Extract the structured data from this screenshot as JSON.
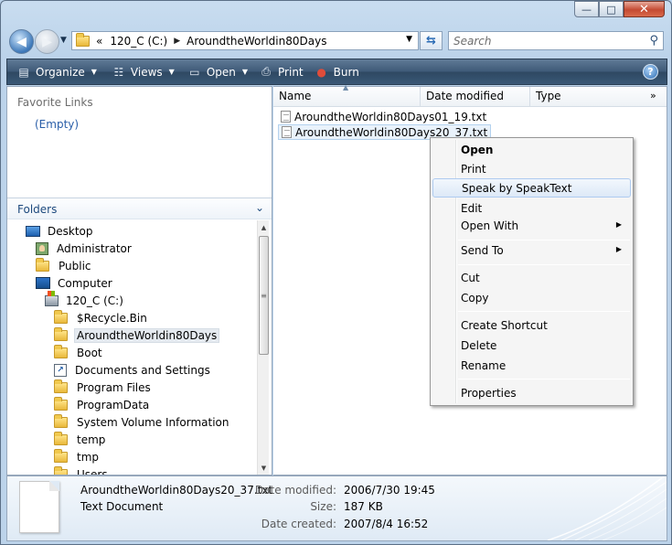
{
  "window": {
    "caption_buttons": {
      "minimize": "—",
      "maximize": "□",
      "close": "✕"
    }
  },
  "nav": {
    "back": "◀",
    "forward": "▶",
    "address": {
      "overflow": "«",
      "crumbs": [
        "120_C (C:)",
        "AroundtheWorldin80Days"
      ]
    },
    "search_placeholder": "Search"
  },
  "toolbar": {
    "items": [
      {
        "label": "Organize",
        "icon": "organize-icon",
        "dropdown": true
      },
      {
        "label": "Views",
        "icon": "views-icon",
        "dropdown": true
      },
      {
        "label": "Open",
        "icon": "open-icon",
        "dropdown": true
      },
      {
        "label": "Print",
        "icon": "printer-icon",
        "dropdown": false
      },
      {
        "label": "Burn",
        "icon": "burn-disc-icon",
        "dropdown": false
      }
    ],
    "help": "?"
  },
  "left": {
    "favorites_title": "Favorite Links",
    "favorites_empty": "(Empty)",
    "folders_title": "Folders",
    "tree": [
      {
        "label": "Desktop",
        "icon": "desktop",
        "indent": 0
      },
      {
        "label": "Administrator",
        "icon": "user",
        "indent": 1
      },
      {
        "label": "Public",
        "icon": "folder",
        "indent": 1
      },
      {
        "label": "Computer",
        "icon": "computer",
        "indent": 1
      },
      {
        "label": "120_C (C:)",
        "icon": "drive",
        "indent": 2
      },
      {
        "label": "$Recycle.Bin",
        "icon": "folder",
        "indent": 3
      },
      {
        "label": "AroundtheWorldin80Days",
        "icon": "folder",
        "indent": 3,
        "selected": true
      },
      {
        "label": "Boot",
        "icon": "folder",
        "indent": 3
      },
      {
        "label": "Documents and Settings",
        "icon": "shortcut",
        "indent": 3
      },
      {
        "label": "Program Files",
        "icon": "folder",
        "indent": 3
      },
      {
        "label": "ProgramData",
        "icon": "folder",
        "indent": 3
      },
      {
        "label": "System Volume Information",
        "icon": "folder",
        "indent": 3
      },
      {
        "label": "temp",
        "icon": "folder",
        "indent": 3
      },
      {
        "label": "tmp",
        "icon": "folder",
        "indent": 3
      },
      {
        "label": "Users",
        "icon": "folder",
        "indent": 3
      }
    ]
  },
  "right": {
    "columns": [
      "Name",
      "Date modified",
      "Type",
      "»"
    ],
    "files": [
      {
        "name": "AroundtheWorldin80Days01_19.txt"
      },
      {
        "name": "AroundtheWorldin80Days20_37.txt",
        "selected": true
      }
    ]
  },
  "context_menu": {
    "items": [
      {
        "label": "Open",
        "bold": true
      },
      {
        "label": "Print"
      },
      {
        "label": "Speak by SpeakText",
        "highlighted": true
      },
      {
        "label": "Edit"
      },
      {
        "label": "Open With",
        "submenu": true
      },
      {
        "sep": true
      },
      {
        "label": "Send To",
        "submenu": true
      },
      {
        "sep": true
      },
      {
        "label": "Cut"
      },
      {
        "label": "Copy"
      },
      {
        "sep": true
      },
      {
        "label": "Create Shortcut"
      },
      {
        "label": "Delete"
      },
      {
        "label": "Rename"
      },
      {
        "sep": true
      },
      {
        "label": "Properties"
      }
    ]
  },
  "details": {
    "name": "AroundtheWorldin80Days20_37.txt",
    "type": "Text Document",
    "fields": [
      {
        "label": "Date modified:",
        "value": "2006/7/30 19:45"
      },
      {
        "label": "Size:",
        "value": "187 KB"
      },
      {
        "label": "Date created:",
        "value": "2007/8/4 16:52"
      }
    ]
  },
  "colors": {
    "accent": "#2a5ea8",
    "toolbar_bg": "#3e5977",
    "selection": "#e9f2fb",
    "menu_highlight": "#dde9f7"
  }
}
